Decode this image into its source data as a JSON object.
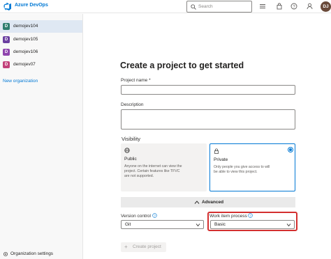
{
  "header": {
    "brand": "Azure DevOps",
    "search_placeholder": "Search",
    "avatar_initials": "DJ",
    "icons": [
      "list-icon",
      "shopping-bag-icon",
      "help-icon",
      "person-settings-icon"
    ]
  },
  "sidebar": {
    "organizations": [
      {
        "label": "demojev104",
        "initial": "D",
        "color": "#2d7d6e",
        "selected": true
      },
      {
        "label": "demojev105",
        "initial": "D",
        "color": "#6b3fa0",
        "selected": false
      },
      {
        "label": "demojev106",
        "initial": "D",
        "color": "#8e44ad",
        "selected": false
      },
      {
        "label": "demojev07",
        "initial": "D",
        "color": "#c2417a",
        "selected": false
      }
    ],
    "new_org_label": "New organization",
    "settings_label": "Organization settings"
  },
  "form": {
    "title": "Create a project to get started",
    "project_name_label": "Project name *",
    "project_name_value": "",
    "description_label": "Description",
    "description_value": "",
    "visibility_label": "Visibility",
    "public": {
      "title": "Public",
      "description": "Anyone on the internet can view the project. Certain features like TFVC are not supported."
    },
    "private": {
      "title": "Private",
      "description": "Only people you give access to will be able to view this project.",
      "selected": true
    },
    "advanced_label": "Advanced",
    "version_control_label": "Version control",
    "version_control_value": "Git",
    "work_item_process_label": "Work item process",
    "work_item_process_value": "Basic",
    "create_button_label": "Create project"
  },
  "colors": {
    "accent": "#0078d4",
    "highlight": "#d32f2f"
  }
}
